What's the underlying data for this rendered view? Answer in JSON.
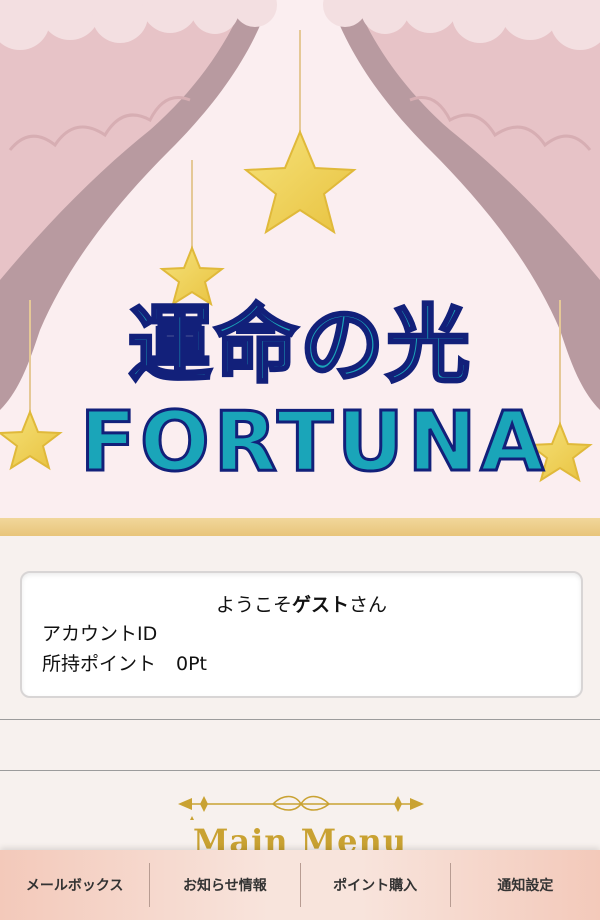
{
  "hero": {
    "logo_jp": "運命の光",
    "logo_en": "FORTUNA"
  },
  "welcome": {
    "prefix": "ようこそ",
    "user": "ゲスト",
    "suffix": "さん",
    "account_id_label": "アカウントID",
    "points_label": "所持ポイント",
    "points_value": "0Pt"
  },
  "menu": {
    "heading": "Main Menu"
  },
  "bottom_nav": {
    "items": [
      {
        "label": "メールボックス"
      },
      {
        "label": "お知らせ情報"
      },
      {
        "label": "ポイント購入"
      },
      {
        "label": "通知設定"
      }
    ]
  },
  "colors": {
    "curtain_light": "#e9c6ca",
    "curtain_dark": "#b89aa0",
    "gold": "#e9c677",
    "logo_fill": "#1aa5b9",
    "logo_outline": "#12207a"
  }
}
